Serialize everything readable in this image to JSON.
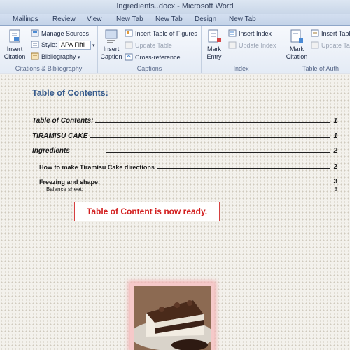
{
  "window": {
    "title": "Ingredients..docx - Microsoft Word"
  },
  "tabs": [
    {
      "label": "Mailings"
    },
    {
      "label": "Review"
    },
    {
      "label": "View"
    },
    {
      "label": "New Tab"
    },
    {
      "label": "New Tab"
    },
    {
      "label": "Design"
    },
    {
      "label": "New Tab"
    }
  ],
  "ribbon": {
    "citations": {
      "group_label": "Citations & Bibliography",
      "insert_citation_line1": "Insert",
      "insert_citation_line2": "Citation",
      "manage_sources": "Manage Sources",
      "style_label": "Style:",
      "style_value": "APA Fifti",
      "bibliography": "Bibliography"
    },
    "captions": {
      "group_label": "Captions",
      "insert_caption_line1": "Insert",
      "insert_caption_line2": "Caption",
      "insert_table_of_figures": "Insert Table of Figures",
      "update_table": "Update Table",
      "cross_reference": "Cross-reference"
    },
    "index": {
      "group_label": "Index",
      "mark_entry_line1": "Mark",
      "mark_entry_line2": "Entry",
      "insert_index": "Insert Index",
      "update_index": "Update Index"
    },
    "authorities": {
      "group_label": "Table of Auth",
      "mark_citation_line1": "Mark",
      "mark_citation_line2": "Citation",
      "insert_table": "Insert Tabl",
      "update_table": "Update Ta"
    }
  },
  "document": {
    "toc_title": "Table of Contents:",
    "entries": [
      {
        "text": "Table of Contents:",
        "page": "1"
      },
      {
        "text": "TIRAMISU CAKE",
        "page": "1"
      },
      {
        "text": "Ingredients",
        "page": "2"
      },
      {
        "text": "How to make Tiramisu Cake directions",
        "page": "2"
      },
      {
        "text": "Freezing and shape:",
        "page": "3"
      },
      {
        "text": "Balance sheet:",
        "page": "3"
      }
    ],
    "callout": "Table of Content is now ready."
  },
  "colors": {
    "callout_red": "#d21d1d",
    "heading_blue": "#365a8c"
  }
}
